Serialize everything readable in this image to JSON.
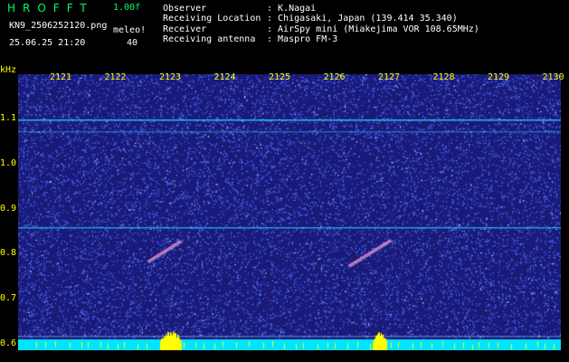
{
  "header": {
    "logo": "HROFFT",
    "version": "1.00f",
    "filename": "KN9_2506252120.png",
    "unit": "meleo!",
    "datetime": "25.06.25 21:20",
    "count": "40"
  },
  "info": [
    {
      "label": "Observer",
      "value": ": K.Nagai"
    },
    {
      "label": "Receiving Location",
      "value": ": Chigasaki, Japan (139.414 35.340)"
    },
    {
      "label": "Receiver",
      "value": ": AirSpy mini (Miakejima VOR 108.65MHz)"
    },
    {
      "label": "Receiving antenna",
      "value": ": Maspro FM-3"
    }
  ],
  "axis": {
    "y_unit": "kHz",
    "y_ticks": [
      "1.1",
      "1.0",
      "0.9",
      "0.8",
      "0.7",
      "0.6"
    ],
    "x_ticks": [
      "2121",
      "2122",
      "2123",
      "2124",
      "2125",
      "2126",
      "2127",
      "2128",
      "2129",
      "2130"
    ]
  },
  "colors": {
    "background": "#1a1a78",
    "noise": "#4a6cff",
    "trace": "#22d3ff",
    "signal": "#ffffff",
    "bottom_bar": "#00e5ff",
    "peak": "#ffff00"
  }
}
